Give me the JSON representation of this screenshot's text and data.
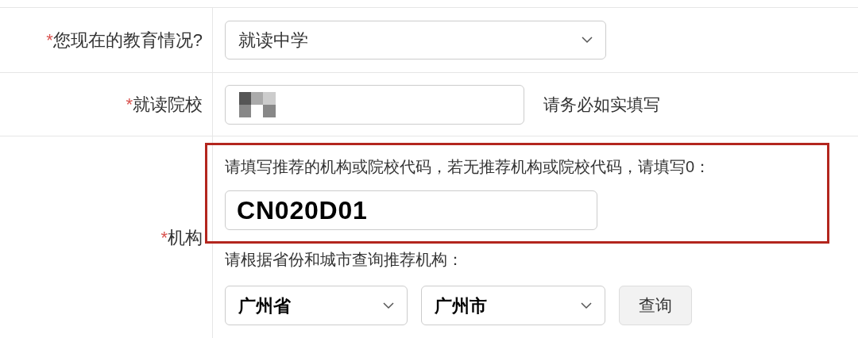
{
  "rows": [
    {
      "kind": "select",
      "required_mark": "*",
      "label": "您现在的教育情况?",
      "value": "就读中学"
    },
    {
      "kind": "text",
      "required_mark": "*",
      "label": "就读院校",
      "redacted": true,
      "hint": "请务必如实填写"
    },
    {
      "kind": "institution",
      "required_mark": "*",
      "label": "机构",
      "prompt": "请填写推荐的机构或院校代码，若无推荐机构或院校代码，请填写0：",
      "value": "CN020D01",
      "highlighted": true,
      "search_prompt": "请根据省份和城市查询推荐机构：",
      "province": "广州省",
      "city": "广州市",
      "button": "查询"
    }
  ]
}
